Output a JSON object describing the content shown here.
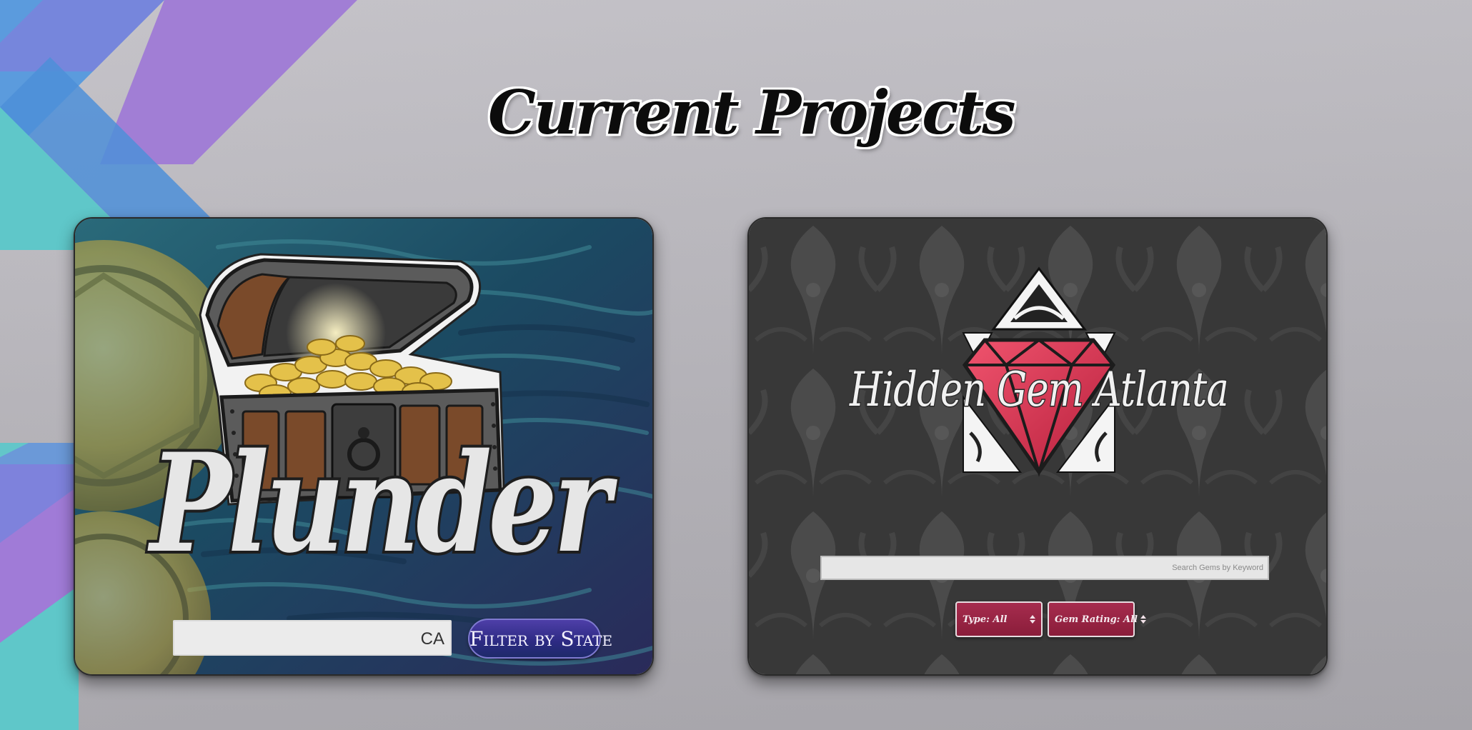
{
  "page": {
    "title": "Current Projects"
  },
  "colors": {
    "background": "#b9b7bd",
    "deco_purple": "#9e7bd6",
    "deco_blue": "#4fa0e0",
    "deco_teal": "#5fc9c8",
    "plunder_ocean": "#1f4a5e",
    "plunder_button": "#2c2a82",
    "gem_red": "#d8314f",
    "gem_select": "#8a1d3a",
    "gem_background": "#3a3a3a"
  },
  "projects": [
    {
      "id": "plunder",
      "logo_text": "Plunder",
      "search": {
        "value": "CA"
      },
      "button_label": "Filter by State",
      "icons": [
        "treasure-chest-icon",
        "gold-coin-icon"
      ]
    },
    {
      "id": "hidden-gem-atlanta",
      "logo_text": "Hidden Gem Atlanta",
      "search": {
        "placeholder": "Search Gems by Keyword"
      },
      "filters": [
        {
          "label": "Type: All"
        },
        {
          "label": "Gem Rating: All"
        }
      ],
      "icons": [
        "gem-icon"
      ]
    }
  ]
}
